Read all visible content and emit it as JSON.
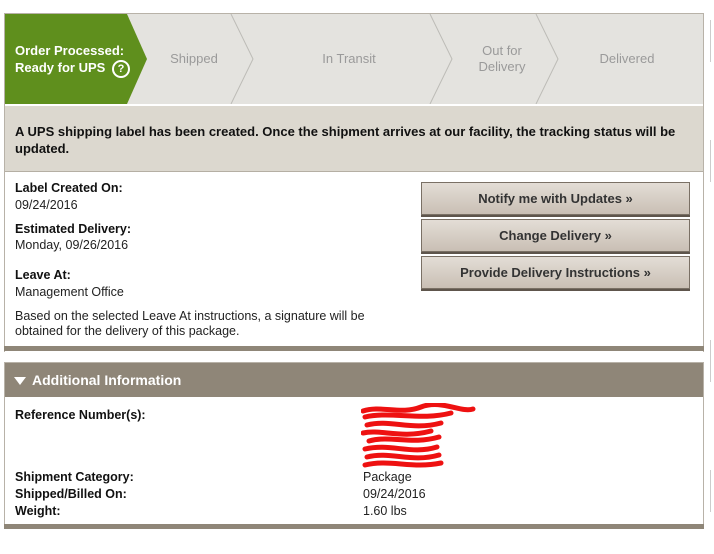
{
  "tracker": {
    "active_line1": "Order Processed:",
    "active_line2": "Ready for UPS",
    "help_glyph": "?",
    "steps": [
      {
        "line1": "Shipped"
      },
      {
        "line1": "In Transit"
      },
      {
        "line1": "Out for",
        "line2": "Delivery"
      },
      {
        "line1": "Delivered"
      }
    ],
    "active_color": "#5f8f1d"
  },
  "notice": "A UPS shipping label has been created. Once the shipment arrives at our facility, the tracking status will be updated.",
  "details": {
    "label_created_label": "Label Created On:",
    "label_created_value": "09/24/2016",
    "est_delivery_label": "Estimated Delivery:",
    "est_delivery_value": "Monday, 09/26/2016",
    "leave_at_label": "Leave At:",
    "leave_at_value": "Management Office",
    "signature_note_line1": "Based on the selected Leave At instructions, a signature will be",
    "signature_note_line2": "obtained for the delivery of this package."
  },
  "buttons": {
    "notify": "Notify me with Updates »",
    "change": "Change Delivery »",
    "instructions": "Provide Delivery Instructions »"
  },
  "additional": {
    "header": "Additional Information",
    "reference_label": "Reference Number(s):",
    "shipment_category_label": "Shipment Category:",
    "shipment_category_value": "Package",
    "shipped_billed_label": "Shipped/Billed On:",
    "shipped_billed_value": "09/24/2016",
    "weight_label": "Weight:",
    "weight_value": "1.60 lbs"
  }
}
